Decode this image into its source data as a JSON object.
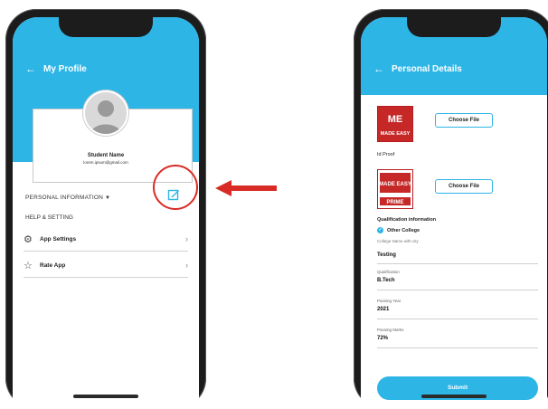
{
  "profile": {
    "title": "My Profile",
    "student_name": "Student Name",
    "student_email": "lorem.ipsum@gmail.com",
    "personal_info": "PERSONAL INFORMATION",
    "help_setting": "HELP & SETTING",
    "menu": [
      {
        "label": "App Settings",
        "icon": "gear-icon"
      },
      {
        "label": "Rate App",
        "icon": "star-icon"
      }
    ]
  },
  "details": {
    "title": "Personal Details",
    "choose_file_1": "Choose File",
    "id_proof": "Id Proof",
    "choose_file_2": "Choose File",
    "qualification_info": "Qualification information",
    "other_college": "Other College",
    "college_hint": "College Name with city",
    "testing": "Testing",
    "fields": [
      {
        "label": "Qualification",
        "value": "B.Tech"
      },
      {
        "label": "Passing Year",
        "value": "2021"
      },
      {
        "label": "Passing Marks",
        "value": "72%"
      }
    ],
    "submit": "Submit"
  },
  "logos": {
    "made_easy_icon": "ME",
    "made_easy_text": "MADE EASY",
    "prime_text": "PRIME"
  },
  "colors": {
    "accent": "#2db5e6",
    "highlight": "#d92b26",
    "brand_red": "#b71c1c"
  }
}
